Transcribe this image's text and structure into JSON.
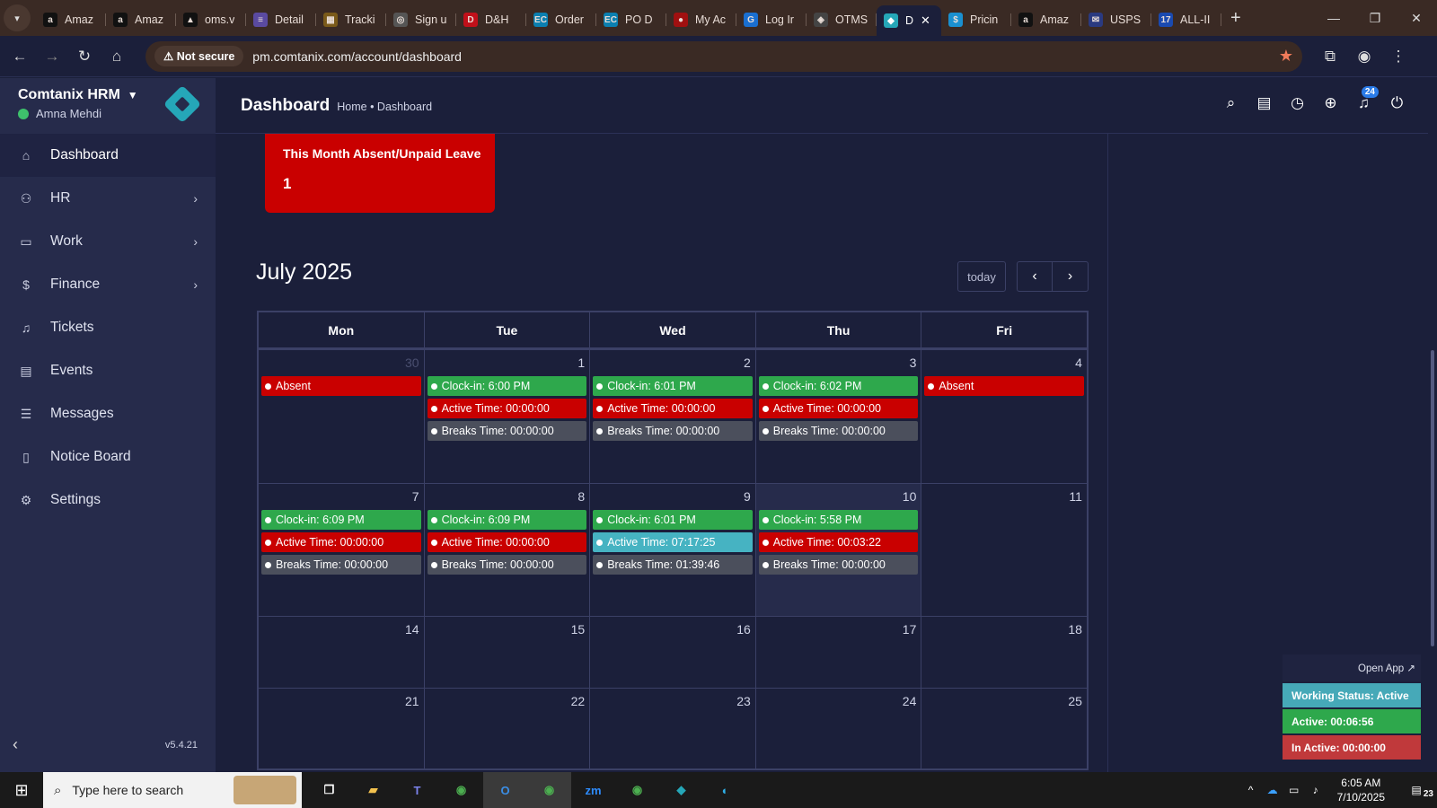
{
  "browser": {
    "tabs": [
      {
        "label": "Amaz",
        "fav": "a",
        "color": "#111"
      },
      {
        "label": "Amaz",
        "fav": "a",
        "color": "#111"
      },
      {
        "label": "oms.v",
        "fav": "▲",
        "color": "#111"
      },
      {
        "label": "Detail",
        "fav": "≡",
        "color": "#5a4aa0"
      },
      {
        "label": "Tracki",
        "fav": "▦",
        "color": "#7a5a1a"
      },
      {
        "label": "Sign u",
        "fav": "◎",
        "color": "#555"
      },
      {
        "label": "D&H",
        "fav": "D",
        "color": "#c0101a"
      },
      {
        "label": "Order",
        "fav": "EC",
        "color": "#0b7fb0"
      },
      {
        "label": "PO D",
        "fav": "EC",
        "color": "#0b7fb0"
      },
      {
        "label": "My Ac",
        "fav": "●",
        "color": "#a01010"
      },
      {
        "label": "Log Ir",
        "fav": "G",
        "color": "#1a6fd0"
      },
      {
        "label": "OTMS",
        "fav": "◈",
        "color": "#444"
      },
      {
        "label": "D",
        "fav": "◆",
        "color": "#25a7b8",
        "active": true
      },
      {
        "label": "Pricin",
        "fav": "$",
        "color": "#1a90d0"
      },
      {
        "label": "Amaz",
        "fav": "a",
        "color": "#111"
      },
      {
        "label": "USPS",
        "fav": "✉",
        "color": "#2a3a80"
      },
      {
        "label": "ALL-II",
        "fav": "17",
        "color": "#1a4ab0"
      }
    ],
    "not_secure": "Not secure",
    "url": "pm.comtanix.com/account/dashboard"
  },
  "sidebar": {
    "app_name": "Comtanix HRM",
    "user_name": "Amna Mehdi",
    "items": [
      {
        "label": "Dashboard",
        "icon": "⌂",
        "name": "dashboard",
        "chevron": false,
        "active": true
      },
      {
        "label": "HR",
        "icon": "⚇",
        "name": "hr",
        "chevron": true
      },
      {
        "label": "Work",
        "icon": "▭",
        "name": "work",
        "chevron": true
      },
      {
        "label": "Finance",
        "icon": "$",
        "name": "finance",
        "chevron": true
      },
      {
        "label": "Tickets",
        "icon": "♫",
        "name": "tickets",
        "chevron": false
      },
      {
        "label": "Events",
        "icon": "▤",
        "name": "events",
        "chevron": false
      },
      {
        "label": "Messages",
        "icon": "☰",
        "name": "messages",
        "chevron": false
      },
      {
        "label": "Notice Board",
        "icon": "▯",
        "name": "notice-board",
        "chevron": false
      },
      {
        "label": "Settings",
        "icon": "⚙",
        "name": "settings",
        "chevron": false
      }
    ],
    "version": "v5.4.21"
  },
  "header": {
    "title": "Dashboard",
    "breadcrumb": "Home • Dashboard",
    "notification_count": "24"
  },
  "absent_card": {
    "title": "This Month Absent/Unpaid Leave",
    "value": "1"
  },
  "calendar": {
    "title": "July 2025",
    "today_label": "today",
    "days": [
      "Mon",
      "Tue",
      "Wed",
      "Thu",
      "Fri"
    ],
    "colors": {
      "green": "#2ea84c",
      "red": "#c90000",
      "gray": "#4b4f5c",
      "teal": "#46b3c2"
    },
    "weeks": [
      {
        "height": 148,
        "cells": [
          {
            "day": "30",
            "muted": true,
            "events": [
              {
                "text": "Absent",
                "color": "red"
              }
            ]
          },
          {
            "day": "1",
            "events": [
              {
                "text": "Clock-in: 6:00 PM",
                "color": "green"
              },
              {
                "text": "Active Time: 00:00:00",
                "color": "red"
              },
              {
                "text": "Breaks Time: 00:00:00",
                "color": "gray"
              }
            ]
          },
          {
            "day": "2",
            "events": [
              {
                "text": "Clock-in: 6:01 PM",
                "color": "green"
              },
              {
                "text": "Active Time: 00:00:00",
                "color": "red"
              },
              {
                "text": "Breaks Time: 00:00:00",
                "color": "gray"
              }
            ]
          },
          {
            "day": "3",
            "events": [
              {
                "text": "Clock-in: 6:02 PM",
                "color": "green"
              },
              {
                "text": "Active Time: 00:00:00",
                "color": "red"
              },
              {
                "text": "Breaks Time: 00:00:00",
                "color": "gray"
              }
            ]
          },
          {
            "day": "4",
            "events": [
              {
                "text": "Absent",
                "color": "red"
              }
            ]
          }
        ]
      },
      {
        "height": 148,
        "cells": [
          {
            "day": "7",
            "events": [
              {
                "text": "Clock-in: 6:09 PM",
                "color": "green"
              },
              {
                "text": "Active Time: 00:00:00",
                "color": "red"
              },
              {
                "text": "Breaks Time: 00:00:00",
                "color": "gray"
              }
            ]
          },
          {
            "day": "8",
            "events": [
              {
                "text": "Clock-in: 6:09 PM",
                "color": "green"
              },
              {
                "text": "Active Time: 00:00:00",
                "color": "red"
              },
              {
                "text": "Breaks Time: 00:00:00",
                "color": "gray"
              }
            ]
          },
          {
            "day": "9",
            "events": [
              {
                "text": "Clock-in: 6:01 PM",
                "color": "green"
              },
              {
                "text": "Active Time: 07:17:25",
                "color": "teal"
              },
              {
                "text": "Breaks Time: 01:39:46",
                "color": "gray"
              }
            ]
          },
          {
            "day": "10",
            "today": true,
            "events": [
              {
                "text": "Clock-in: 5:58 PM",
                "color": "green"
              },
              {
                "text": "Active Time: 00:03:22",
                "color": "red"
              },
              {
                "text": "Breaks Time: 00:00:00",
                "color": "gray"
              }
            ]
          },
          {
            "day": "11",
            "events": []
          }
        ]
      },
      {
        "height": 80,
        "cells": [
          {
            "day": "14",
            "events": []
          },
          {
            "day": "15",
            "events": []
          },
          {
            "day": "16",
            "events": []
          },
          {
            "day": "17",
            "events": []
          },
          {
            "day": "18",
            "events": []
          }
        ]
      },
      {
        "height": 90,
        "cells": [
          {
            "day": "21",
            "events": []
          },
          {
            "day": "22",
            "events": []
          },
          {
            "day": "23",
            "events": []
          },
          {
            "day": "24",
            "events": []
          },
          {
            "day": "25",
            "events": []
          }
        ]
      }
    ]
  },
  "status_widget": {
    "open_app": "Open App ↗",
    "working_status": "Working Status: Active",
    "active": "Active: 00:06:56",
    "inactive": "In Active: 00:00:00",
    "colors": {
      "working": "#46a9b8",
      "active": "#2ea84c",
      "inactive": "#c0393b"
    }
  },
  "taskbar": {
    "search_placeholder": "Type here to search",
    "time": "6:05 AM",
    "date": "7/10/2025",
    "notification_count": "23"
  }
}
